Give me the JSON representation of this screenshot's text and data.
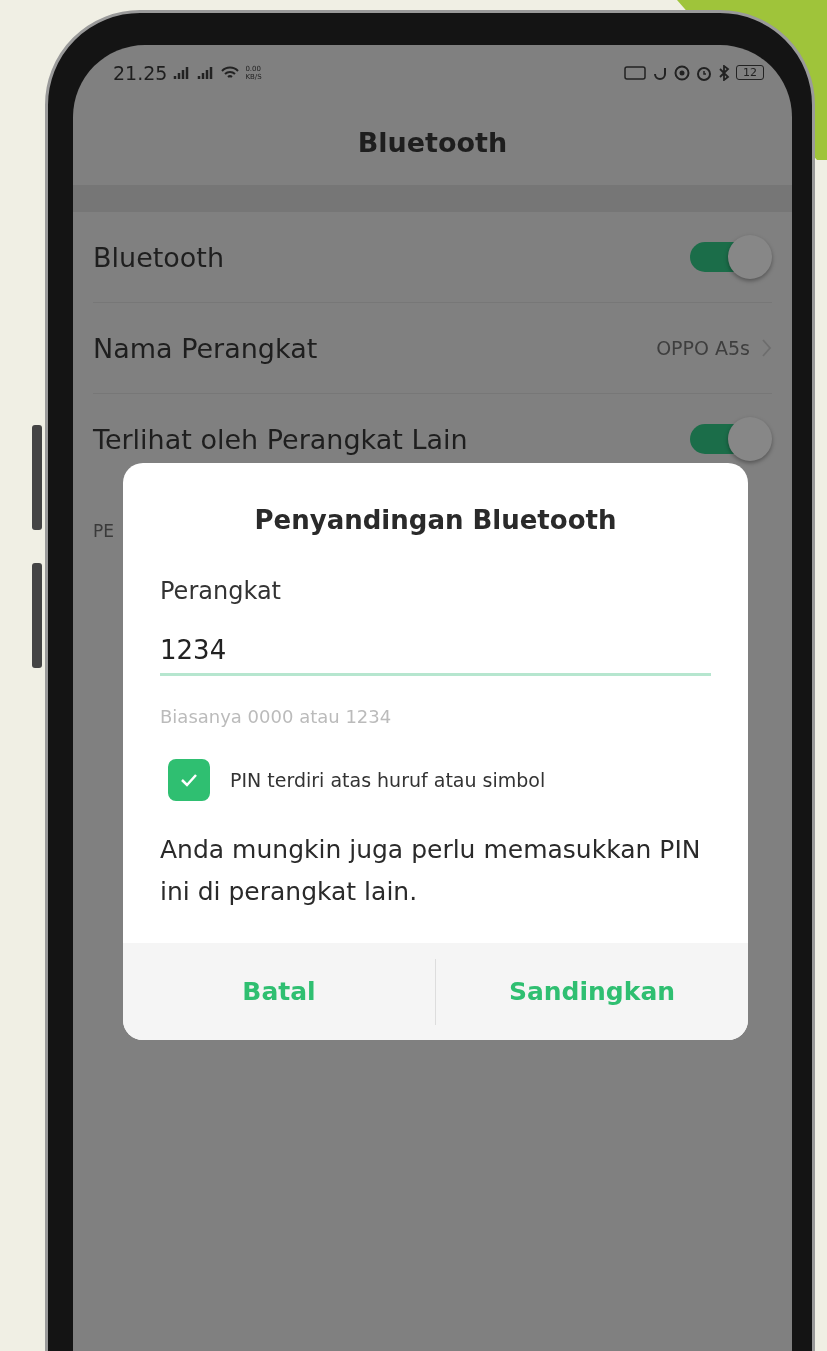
{
  "status_bar": {
    "time": "21.25",
    "net_speed": [
      "0.00",
      "KB/S"
    ],
    "battery": "12"
  },
  "header": {
    "title": "Bluetooth"
  },
  "settings": [
    {
      "kind": "toggle",
      "label": "Bluetooth",
      "on": true
    },
    {
      "kind": "value",
      "label": "Nama Perangkat",
      "value": "OPPO A5s"
    },
    {
      "kind": "toggle",
      "label": "Terlihat oleh Perangkat Lain",
      "on": true
    }
  ],
  "section_label": "PE",
  "dialog": {
    "title": "Penyandingan Bluetooth",
    "field_label": "Perangkat",
    "pin": {
      "value": "1234"
    },
    "hint": "Biasanya 0000 atau 1234",
    "checkbox": {
      "label": "PIN terdiri atas huruf atau simbol",
      "checked": true
    },
    "message": "Anda mungkin juga perlu memasukkan PIN ini di perangkat lain.",
    "buttons": [
      {
        "label": "Batal"
      },
      {
        "label": "Sandingkan"
      }
    ]
  }
}
